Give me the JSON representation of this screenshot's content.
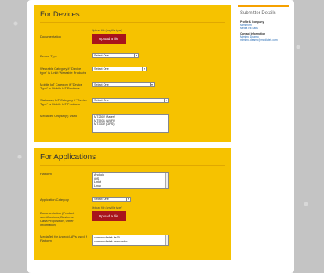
{
  "devices": {
    "title": "For Devices",
    "documentation_label": "Documentation",
    "upload_hint": "Upload file (any file type)",
    "upload_label": "Upload a file",
    "device_type_label": "Device Type",
    "device_type_value": "Select One",
    "wearable_label": "Wearable Category if \"Device type\" is Linkit Wearable Products",
    "wearable_value": "Select One",
    "mobile_iot_label": "Mobile IoT Category if \"Device Type\" is Mobile IoT Products",
    "mobile_iot_value": "Select One",
    "stationary_iot_label": "Stationary IoT Category if \"Device Type\" is Mobile IoT Products",
    "stationary_iot_value": "Select One",
    "chipsets_label": "MediaTek Chipset(s) Used",
    "chipsets": [
      "MT2502 (Aster)",
      "MT5931 (Wi-Fi)",
      "MT3332 (GPS)"
    ]
  },
  "applications": {
    "title": "For Applications",
    "platform_label": "Platform",
    "platforms": [
      "Android",
      "iOS",
      "LinkIt",
      "Linux"
    ],
    "app_category_label": "Application Category",
    "app_category_value": "Select One",
    "documentation_label": "Documentation (Product specifications, Business Case/Proposition, Other information)",
    "upload_hint": "Upload file (any file type)",
    "upload_label": "Upload a file",
    "sdk_label": "MediaTek for Android APIs used if Platform",
    "sdk_items": [
      "com.mediatek.bs00",
      "com.mediatek.camcorder"
    ]
  },
  "sidebar": {
    "title": "Submitter Details",
    "profile_heading": "Profile & Company",
    "profile_name": "Mimimom",
    "company": "MediaTek Labs",
    "contact_heading": "Contact Information",
    "contact_name": "Mimimo Deamo",
    "email": "mimimo.deamo@mediatek.com"
  },
  "colors": {
    "panel": "#f6c200",
    "button": "#a8141c",
    "sidebar_accent": "#f6a100"
  }
}
